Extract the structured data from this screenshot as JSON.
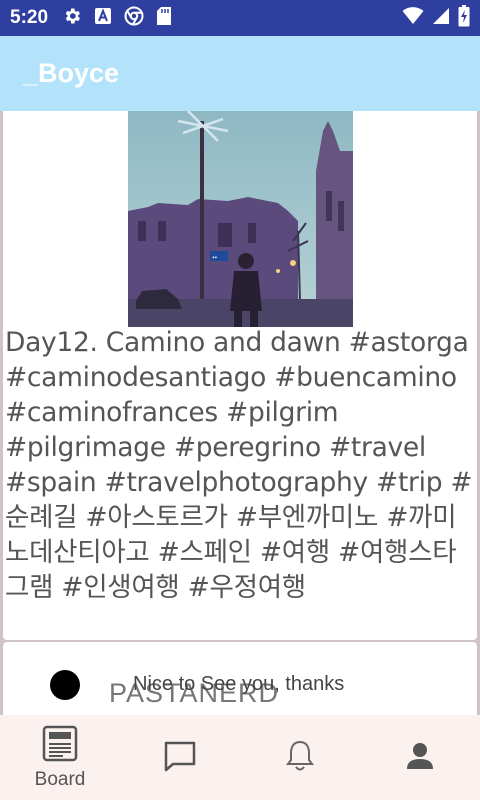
{
  "status_bar": {
    "time": "5:20",
    "left_icons": [
      "gear-icon",
      "keyboard-a-icon",
      "chrome-icon",
      "sd-card-icon"
    ],
    "right_icons": [
      "wifi-icon",
      "signal-icon",
      "battery-icon"
    ]
  },
  "app_bar": {
    "title": "_Boyce"
  },
  "post": {
    "text": "Day12. Camino and dawn #astorga #caminodesantiago #buencamino #caminofrances #pilgrim #pilgrimage #peregrino #travel #spain #travelphotography #trip #순례길 #아스토르가 #부엔까미노 #까미노데산티아고 #스페인 #여행 #여행스타그램 #인생여행 #우정여행"
  },
  "comment": {
    "author": "PASTANERD",
    "text": "Nice to See you, thanks"
  },
  "bottom_nav": {
    "items": [
      {
        "label": "Board",
        "icon": "newspaper-icon"
      },
      {
        "label": "",
        "icon": "chat-icon"
      },
      {
        "label": "",
        "icon": "bell-icon"
      },
      {
        "label": "",
        "icon": "person-icon"
      }
    ]
  },
  "colors": {
    "status_bar": "#2f3f9f",
    "app_bar": "#b3e2fb",
    "bottom_nav": "#fbf1ef"
  }
}
